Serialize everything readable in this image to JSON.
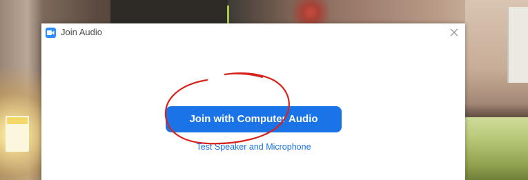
{
  "dialog": {
    "title": "Join Audio",
    "app_icon": "zoom-camera-icon",
    "close_icon": "close-icon"
  },
  "primary_button": {
    "label": "Join with Computer Audio"
  },
  "secondary_link": {
    "label": "Test Speaker and Microphone"
  },
  "colors": {
    "accent": "#1a74e8",
    "annotation": "#d8221c",
    "title_text": "#4a4a4a",
    "dialog_bg": "#ffffff"
  }
}
